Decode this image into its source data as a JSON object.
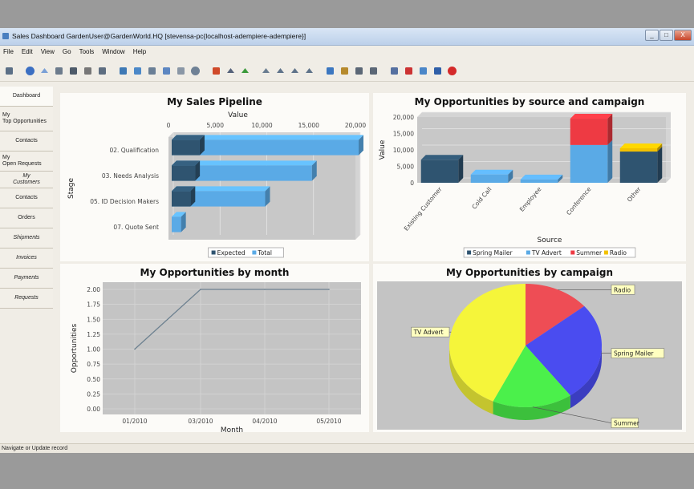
{
  "window": {
    "title": "Sales Dashboard  GardenUser@GardenWorld.HQ [stevensa-pc{localhost-adempiere-adempiere}]",
    "buttons": [
      "_",
      "□",
      "X"
    ]
  },
  "menu": [
    "File",
    "Edit",
    "View",
    "Go",
    "Tools",
    "Window",
    "Help"
  ],
  "toolbar_icons": [
    "undo-icon",
    "help-icon",
    "new-record-icon",
    "copy-icon",
    "delete-icon",
    "delete-selection-icon",
    "save-icon",
    "refresh-icon",
    "find-icon",
    "attachment-icon",
    "chat-icon",
    "grid-toggle-icon",
    "history-icon",
    "home-icon",
    "back-icon",
    "forward-icon",
    "first-record-icon",
    "previous-record-icon",
    "next-record-icon",
    "last-record-icon",
    "report-icon",
    "archive-icon",
    "print-preview-icon",
    "print-icon",
    "zoom-across-icon",
    "active-workflows-icon",
    "request-icon",
    "product-info-icon",
    "end-icon"
  ],
  "sidebar": {
    "items": [
      {
        "label": "Dashboard"
      },
      {
        "label": "My\nTop Opportunities"
      },
      {
        "label": "Contacts"
      },
      {
        "label": "My\nOpen Requests"
      },
      {
        "label": "My\nCustomers"
      },
      {
        "label": "Contacts"
      },
      {
        "label": "Orders"
      },
      {
        "label": "Shipments"
      },
      {
        "label": "Invoices"
      },
      {
        "label": "Payments"
      },
      {
        "label": "Requests"
      }
    ]
  },
  "status": "Navigate or Update record",
  "chart_data": [
    {
      "type": "bar",
      "orientation": "horizontal",
      "title": "My Sales Pipeline",
      "xlabel": "Value",
      "ylabel": "Stage",
      "categories": [
        "02. Qualification",
        "03. Needs Analysis",
        "05. ID Decision Makers",
        "07. Quote Sent"
      ],
      "series": [
        {
          "name": "Expected",
          "values": [
            3000,
            2500,
            2000,
            0
          ],
          "color": "#2f5470"
        },
        {
          "name": "Total",
          "values": [
            20000,
            15000,
            10000,
            1000
          ],
          "color": "#5aaae6"
        }
      ],
      "xlim": [
        0,
        20000
      ],
      "xticks": [
        "0",
        "5,000",
        "10,000",
        "15,000",
        "20,000"
      ],
      "legend_position": "bottom"
    },
    {
      "type": "bar",
      "stacked": true,
      "title": "My Opportunities by source and campaign",
      "xlabel": "Source",
      "ylabel": "Value",
      "categories": [
        "Existing Customer",
        "Cold Call",
        "Employee",
        "Conference",
        "Other"
      ],
      "series": [
        {
          "name": "Spring Mailer",
          "values": [
            7000,
            0,
            0,
            0,
            9500
          ],
          "color": "#2f5470"
        },
        {
          "name": "TV Advert",
          "values": [
            0,
            2500,
            1000,
            11500,
            0
          ],
          "color": "#5aaae6"
        },
        {
          "name": "Summer",
          "values": [
            0,
            0,
            0,
            8000,
            0
          ],
          "color": "#ee3a43"
        },
        {
          "name": "Radio",
          "values": [
            0,
            0,
            0,
            0,
            1000
          ],
          "color": "#f2c100"
        }
      ],
      "ylim": [
        0,
        20000
      ],
      "yticks": [
        "0",
        "5,000",
        "10,000",
        "15,000",
        "20,000"
      ],
      "legend_position": "bottom"
    },
    {
      "type": "line",
      "title": "My Opportunities by month",
      "xlabel": "Month",
      "ylabel": "Opportunities",
      "x": [
        "01/2010",
        "03/2010",
        "04/2010",
        "05/2010"
      ],
      "series": [
        {
          "values": [
            1.0,
            2.0,
            2.0,
            2.0
          ],
          "color": "#6d8190"
        }
      ],
      "ylim": [
        0,
        2.0
      ],
      "yticks": [
        "0.00",
        "0.25",
        "0.50",
        "0.75",
        "1.00",
        "1.25",
        "1.50",
        "1.75",
        "2.00"
      ]
    },
    {
      "type": "pie",
      "title": "My Opportunities by campaign",
      "slices": [
        {
          "label": "Radio",
          "value": 14,
          "color": "#ee4d55"
        },
        {
          "label": "Spring Mailer",
          "value": 26,
          "color": "#4a4cf0"
        },
        {
          "label": "Summer",
          "value": 17,
          "color": "#4bf04b"
        },
        {
          "label": "TV Advert",
          "value": 43,
          "color": "#f5f53a"
        }
      ]
    }
  ]
}
